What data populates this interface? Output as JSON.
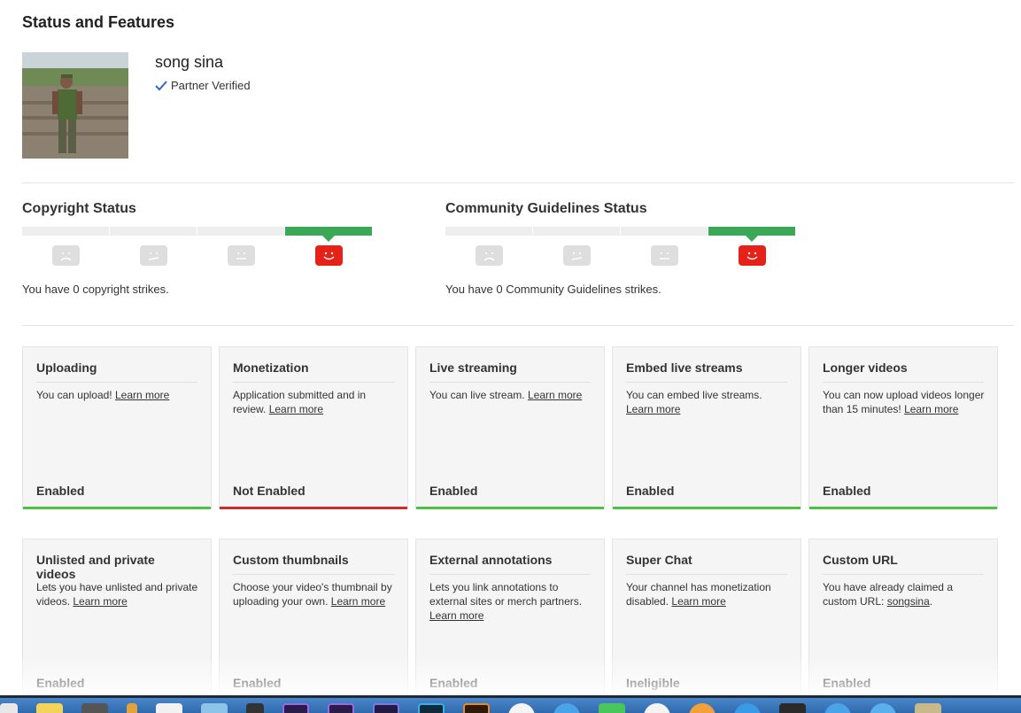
{
  "page": {
    "title": "Status and Features"
  },
  "channel": {
    "name": "song sina",
    "verified_label": "Partner Verified"
  },
  "copyright": {
    "title": "Copyright Status",
    "strikes": 0,
    "text": "You have 0 copyright strikes."
  },
  "community": {
    "title": "Community Guidelines Status",
    "strikes": 0,
    "text": "You have 0 Community Guidelines strikes."
  },
  "colors": {
    "enabled": "#4cc243",
    "not_enabled": "#d22a2a",
    "good_status": "#3aa856",
    "happy_face": "#e62117"
  },
  "features": [
    {
      "title": "Uploading",
      "desc": "You can upload!",
      "link": "Learn more",
      "status": "Enabled",
      "state": "on"
    },
    {
      "title": "Monetization",
      "desc": "Application submitted and in review.",
      "link": "Learn more",
      "status": "Not Enabled",
      "state": "off"
    },
    {
      "title": "Live streaming",
      "desc": "You can live stream.",
      "link": "Learn more",
      "status": "Enabled",
      "state": "on"
    },
    {
      "title": "Embed live streams",
      "desc": "You can embed live streams.",
      "link": "Learn more",
      "status": "Enabled",
      "state": "on"
    },
    {
      "title": "Longer videos",
      "desc": "You can now upload videos longer than 15 minutes!",
      "link": "Learn more",
      "status": "Enabled",
      "state": "on"
    },
    {
      "title": "Unlisted and private videos",
      "desc": "Lets you have unlisted and private videos.",
      "link": "Learn more",
      "status": "Enabled",
      "state": "on"
    },
    {
      "title": "Custom thumbnails",
      "desc": "Choose your video's thumbnail by uploading your own.",
      "link": "Learn more",
      "status": "Enabled",
      "state": "on"
    },
    {
      "title": "External annotations",
      "desc": "Lets you link annotations to external sites or merch partners.",
      "link": "Learn more",
      "status": "Enabled",
      "state": "on"
    },
    {
      "title": "Super Chat",
      "desc": "Your channel has monetization disabled.",
      "link": "Learn more",
      "status": "Ineligible",
      "state": "on"
    },
    {
      "title": "Custom URL",
      "desc": "You have already claimed a custom URL:",
      "link": "songsina",
      "suffix": ".",
      "status": "Enabled",
      "state": "on"
    }
  ]
}
